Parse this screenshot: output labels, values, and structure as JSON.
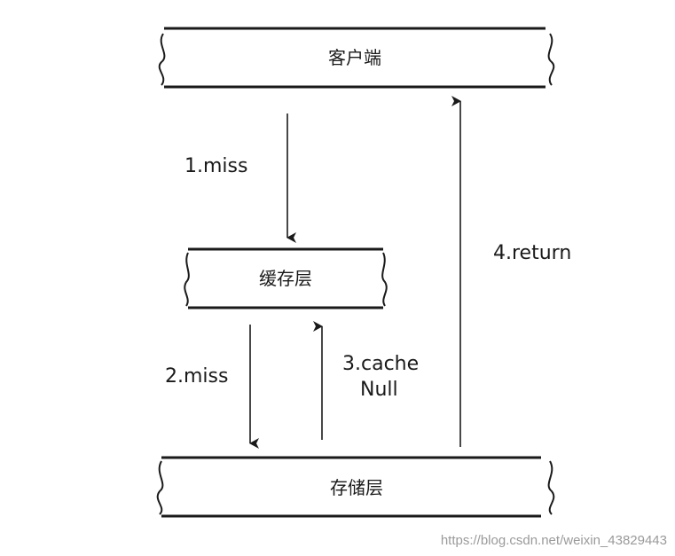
{
  "diagram": {
    "nodes": {
      "client": "客户端",
      "cache": "缓存层",
      "storage": "存储层"
    },
    "edges": {
      "step1": "1.miss",
      "step2": "2.miss",
      "step3_line1": "3.cache",
      "step3_line2": "Null",
      "step4": "4.return"
    }
  },
  "watermark": {
    "text": "https://blog.csdn.net/weixin_43829443"
  }
}
